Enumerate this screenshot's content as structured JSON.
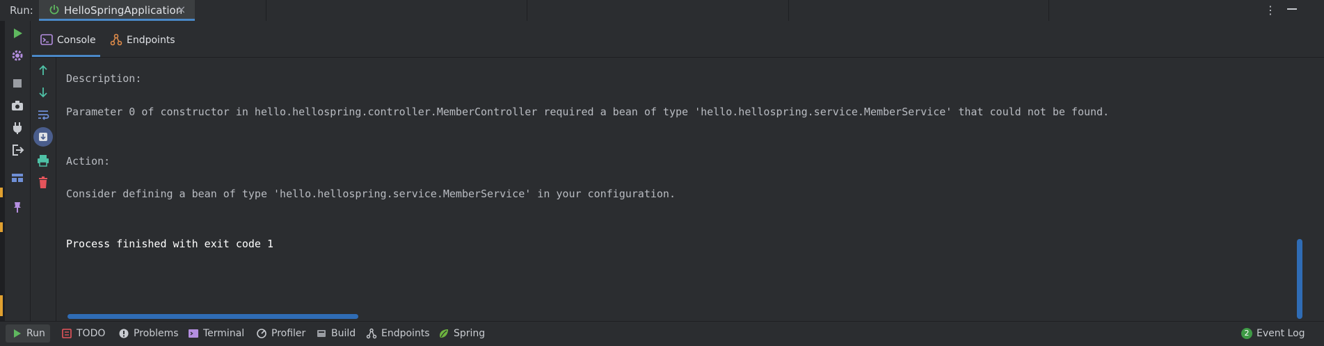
{
  "topbar": {
    "run_label": "Run:",
    "tab_title": "HelloSpringApplication",
    "close_glyph": "×",
    "more_glyph": "⋮"
  },
  "run_toolbar": {
    "icons": [
      "run-icon",
      "settings-icon",
      "stop-icon",
      "camera-icon",
      "plug-icon",
      "exit-icon",
      "layout-icon",
      "pin-icon"
    ]
  },
  "console_tabs": [
    {
      "label": "Console",
      "icon": "console-icon",
      "active": true
    },
    {
      "label": "Endpoints",
      "icon": "endpoints-icon",
      "active": false
    }
  ],
  "console_tools": {
    "icons": [
      "arrow-up-icon",
      "arrow-down-icon",
      "soft-wrap-icon",
      "scroll-to-end-icon",
      "print-icon",
      "trash-icon"
    ]
  },
  "output": {
    "lines": [
      "Description:",
      "Parameter 0 of constructor in hello.hellospring.controller.MemberController required a bean of type 'hello.hellospring.service.MemberService' that could not be found.",
      "Action:",
      "Consider defining a bean of type 'hello.hellospring.service.MemberService' in your configuration.",
      "Process finished with exit code 1"
    ]
  },
  "bottombar": {
    "items": [
      {
        "label": "Run",
        "icon": "run-icon"
      },
      {
        "label": "TODO",
        "icon": "todo-icon"
      },
      {
        "label": "Problems",
        "icon": "problems-icon"
      },
      {
        "label": "Terminal",
        "icon": "terminal-icon"
      },
      {
        "label": "Profiler",
        "icon": "profiler-icon"
      },
      {
        "label": "Build",
        "icon": "build-icon"
      },
      {
        "label": "Endpoints",
        "icon": "endpoints-icon"
      },
      {
        "label": "Spring",
        "icon": "spring-icon"
      }
    ],
    "event_log": {
      "label": "Event Log",
      "count": "2"
    }
  },
  "colors": {
    "background": "#2b2d30",
    "accent": "#4a88c7",
    "run_green": "#5fb85f",
    "danger": "#e5545b"
  }
}
